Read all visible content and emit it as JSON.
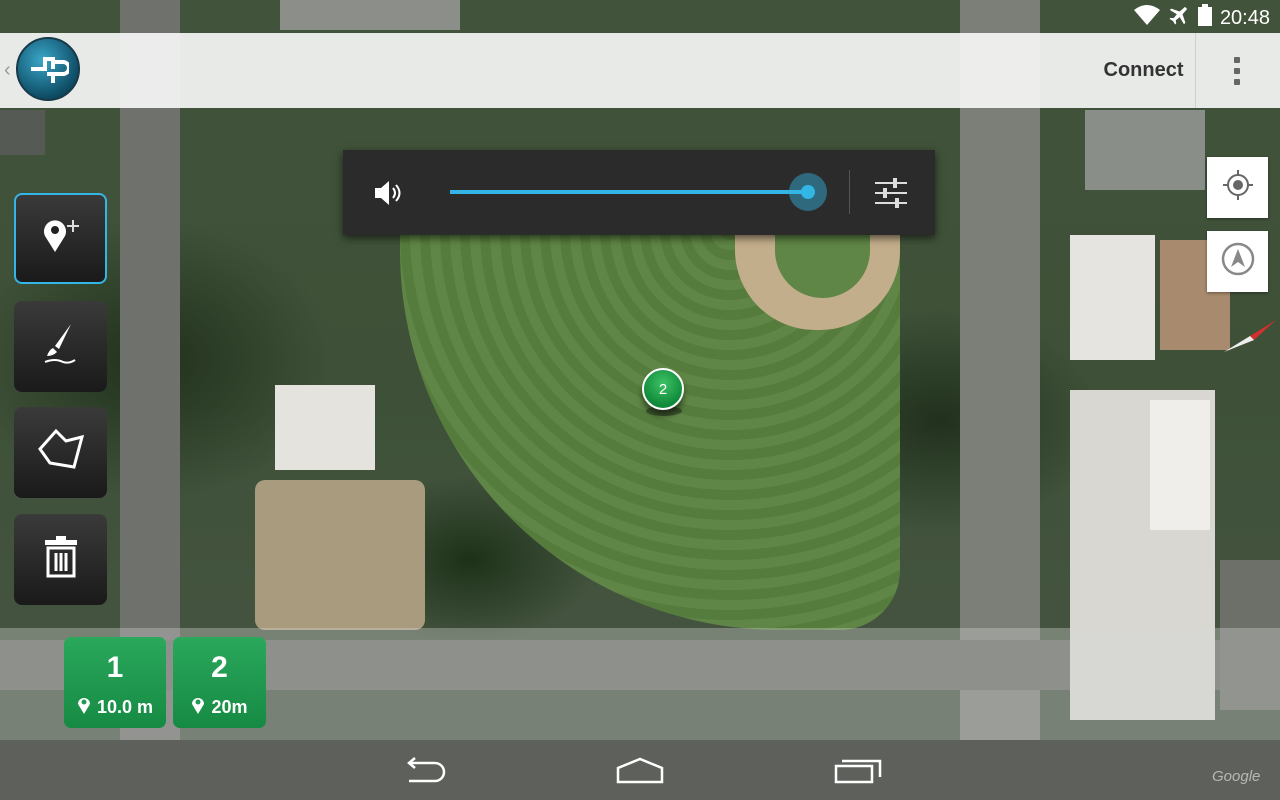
{
  "status_bar": {
    "time": "20:48",
    "icons": [
      "wifi-icon",
      "airplane-icon",
      "battery-icon"
    ]
  },
  "action_bar": {
    "logo_icon": "app-logo-icon",
    "back_icon": "back-caret-icon",
    "connect_label": "Connect",
    "overflow_icon": "overflow-menu-icon"
  },
  "volume_panel": {
    "icon": "speaker-icon",
    "level": 1.0,
    "settings_icon": "sliders-icon",
    "accent_color": "#33b5e5"
  },
  "tools": [
    {
      "name": "add-marker",
      "icon": "map-pin-plus-icon",
      "selected": true
    },
    {
      "name": "draw",
      "icon": "paintbrush-icon",
      "selected": false
    },
    {
      "name": "polygon",
      "icon": "polygon-icon",
      "selected": false
    },
    {
      "name": "delete",
      "icon": "trash-icon",
      "selected": false
    }
  ],
  "map_controls": [
    {
      "name": "my-location",
      "icon": "crosshair-icon"
    },
    {
      "name": "follow-drone",
      "icon": "navigation-arrow-icon"
    }
  ],
  "map": {
    "compass_icon": "compass-needle-icon",
    "marker_label": "2",
    "marker_color": "#1a9c48",
    "attribution": "Google"
  },
  "waypoints": [
    {
      "number": "1",
      "altitude": "10.0 m"
    },
    {
      "number": "2",
      "altitude": "20m"
    }
  ],
  "waypoint_color": "#1f9a50",
  "nav_bar": {
    "buttons": [
      "back-icon",
      "home-icon",
      "recents-icon"
    ]
  }
}
